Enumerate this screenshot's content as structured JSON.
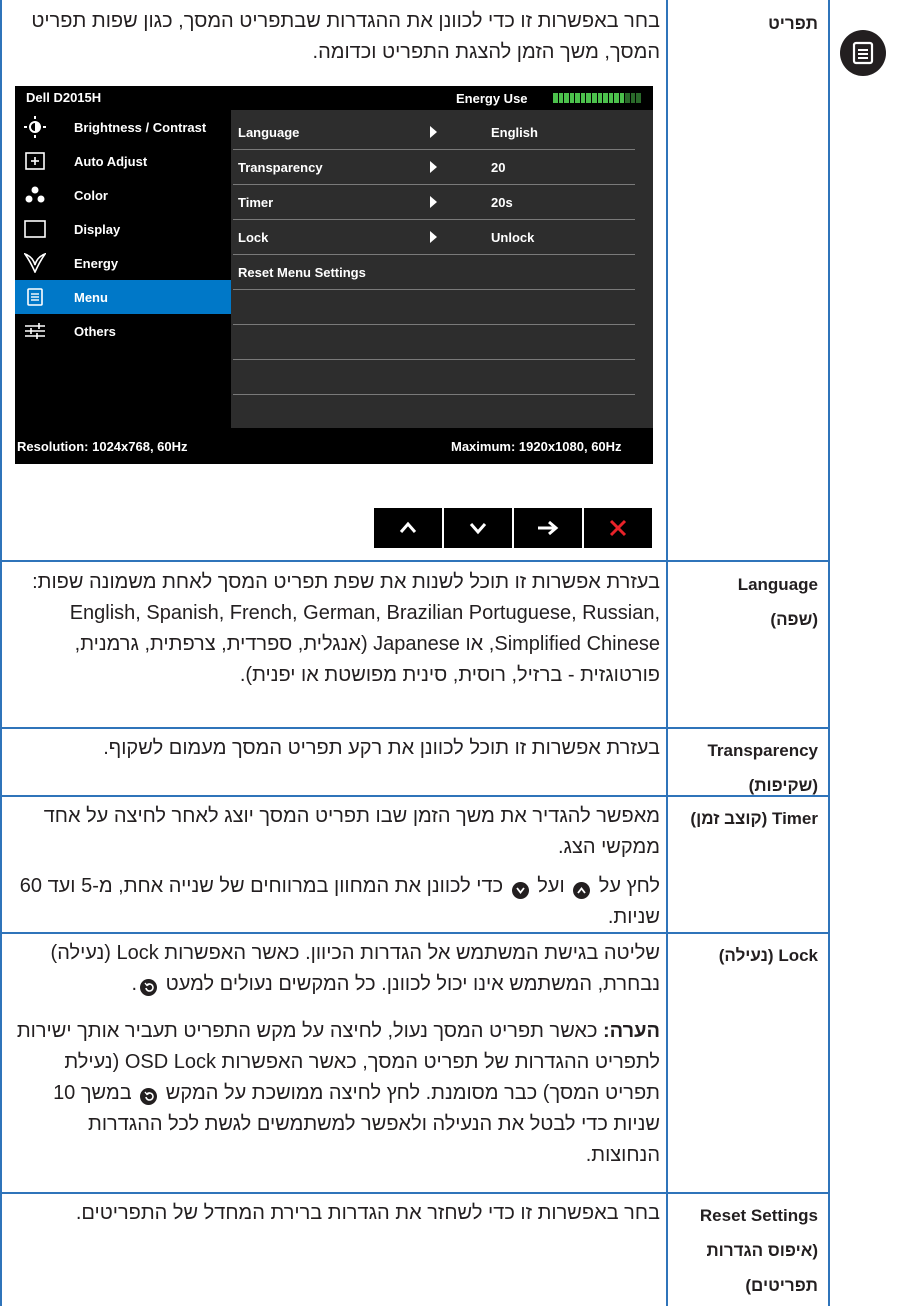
{
  "header": {
    "title": "תפריט",
    "description": "בחר באפשרות זו כדי לכוונן את ההגדרות שבתפריט המסך, כגון שפות תפריט המסך, משך הזמן להצגת התפריט וכדומה."
  },
  "osd": {
    "model": "Dell D2015H",
    "energy_label": "Energy Use",
    "menu_items": [
      {
        "label": "Brightness / Contrast",
        "icon": "brightness-icon"
      },
      {
        "label": "Auto Adjust",
        "icon": "auto-adjust-icon"
      },
      {
        "label": "Color",
        "icon": "color-icon"
      },
      {
        "label": "Display",
        "icon": "display-icon"
      },
      {
        "label": "Energy",
        "icon": "energy-icon"
      },
      {
        "label": "Menu",
        "icon": "menu-icon"
      },
      {
        "label": "Others",
        "icon": "others-icon"
      }
    ],
    "selected_item": "Menu",
    "rows": [
      {
        "key": "Language",
        "value": "English"
      },
      {
        "key": "Transparency",
        "value": "20"
      },
      {
        "key": "Timer",
        "value": "20s"
      },
      {
        "key": "Lock",
        "value": "Unlock"
      },
      {
        "key": "Reset Menu Settings",
        "value": ""
      }
    ],
    "resolution": "Resolution: 1024x768, 60Hz",
    "maximum": "Maximum: 1920x1080, 60Hz"
  },
  "nav_buttons": [
    "up-arrow-icon",
    "down-arrow-icon",
    "right-arrow-icon",
    "close-icon"
  ],
  "sections": {
    "language": {
      "title_en": "Language",
      "title_he": "(שפה)",
      "text": "בעזרת אפשרות זו תוכל לשנות את שפת תפריט המסך לאחת משמונה שפות: English, Spanish, French, German, Brazilian Portuguese, Russian, Simplified Chinese, או Japanese (אנגלית, ספרדית, צרפתית, גרמנית, פורטוגזית - ברזיל, רוסית, סינית מפושטת או יפנית)."
    },
    "transparency": {
      "title_en": "Transparency",
      "title_he": "(שקיפות)",
      "text": "בעזרת אפשרות זו תוכל לכוונן את רקע תפריט המסך מעמום לשקוף."
    },
    "timer": {
      "title": "Timer (קוצב זמן)",
      "text1": "מאפשר להגדיר את משך הזמן שבו תפריט המסך יוצג לאחר לחיצה על אחד ממקשי הצג.",
      "text2_a": "לחץ על",
      "text2_b": "ועל",
      "text2_c": "כדי לכוונן את המחוון במרווחים של שנייה אחת, מ-5 ועד 60 שניות."
    },
    "lock": {
      "title": "Lock (נעילה)",
      "text1": "שליטה בגישת המשתמש אל הגדרות הכיוון. כאשר האפשרות Lock (נעילה) נבחרת, המשתמש אינו יכול לכוונן. כל המקשים נעולים למעט",
      "note_label": "הערה:",
      "note_a": "כאשר תפריט המסך נעול, לחיצה על מקש התפריט תעביר אותך ישירות לתפריט ההגדרות של תפריט המסך, כאשר האפשרות OSD Lock (נעילת תפריט המסך) כבר מסומנת. לחץ לחיצה ממושכת על המקש",
      "note_b": "במשך 10 שניות כדי לבטל את הנעילה ולאפשר למשתמשים לגשת לכל ההגדרות הנחוצות."
    },
    "reset": {
      "title_en": "Reset Settings",
      "title_he": "(איפוס הגדרות תפריטים)",
      "text": "בחר באפשרות זו כדי לשחזר את הגדרות ברירת המחדל של התפריטים."
    }
  },
  "colors": {
    "rule": "#2f74ba",
    "osd_bg": "#2d2d2d",
    "osd_select": "#0078c8",
    "close": "#e8232a"
  }
}
